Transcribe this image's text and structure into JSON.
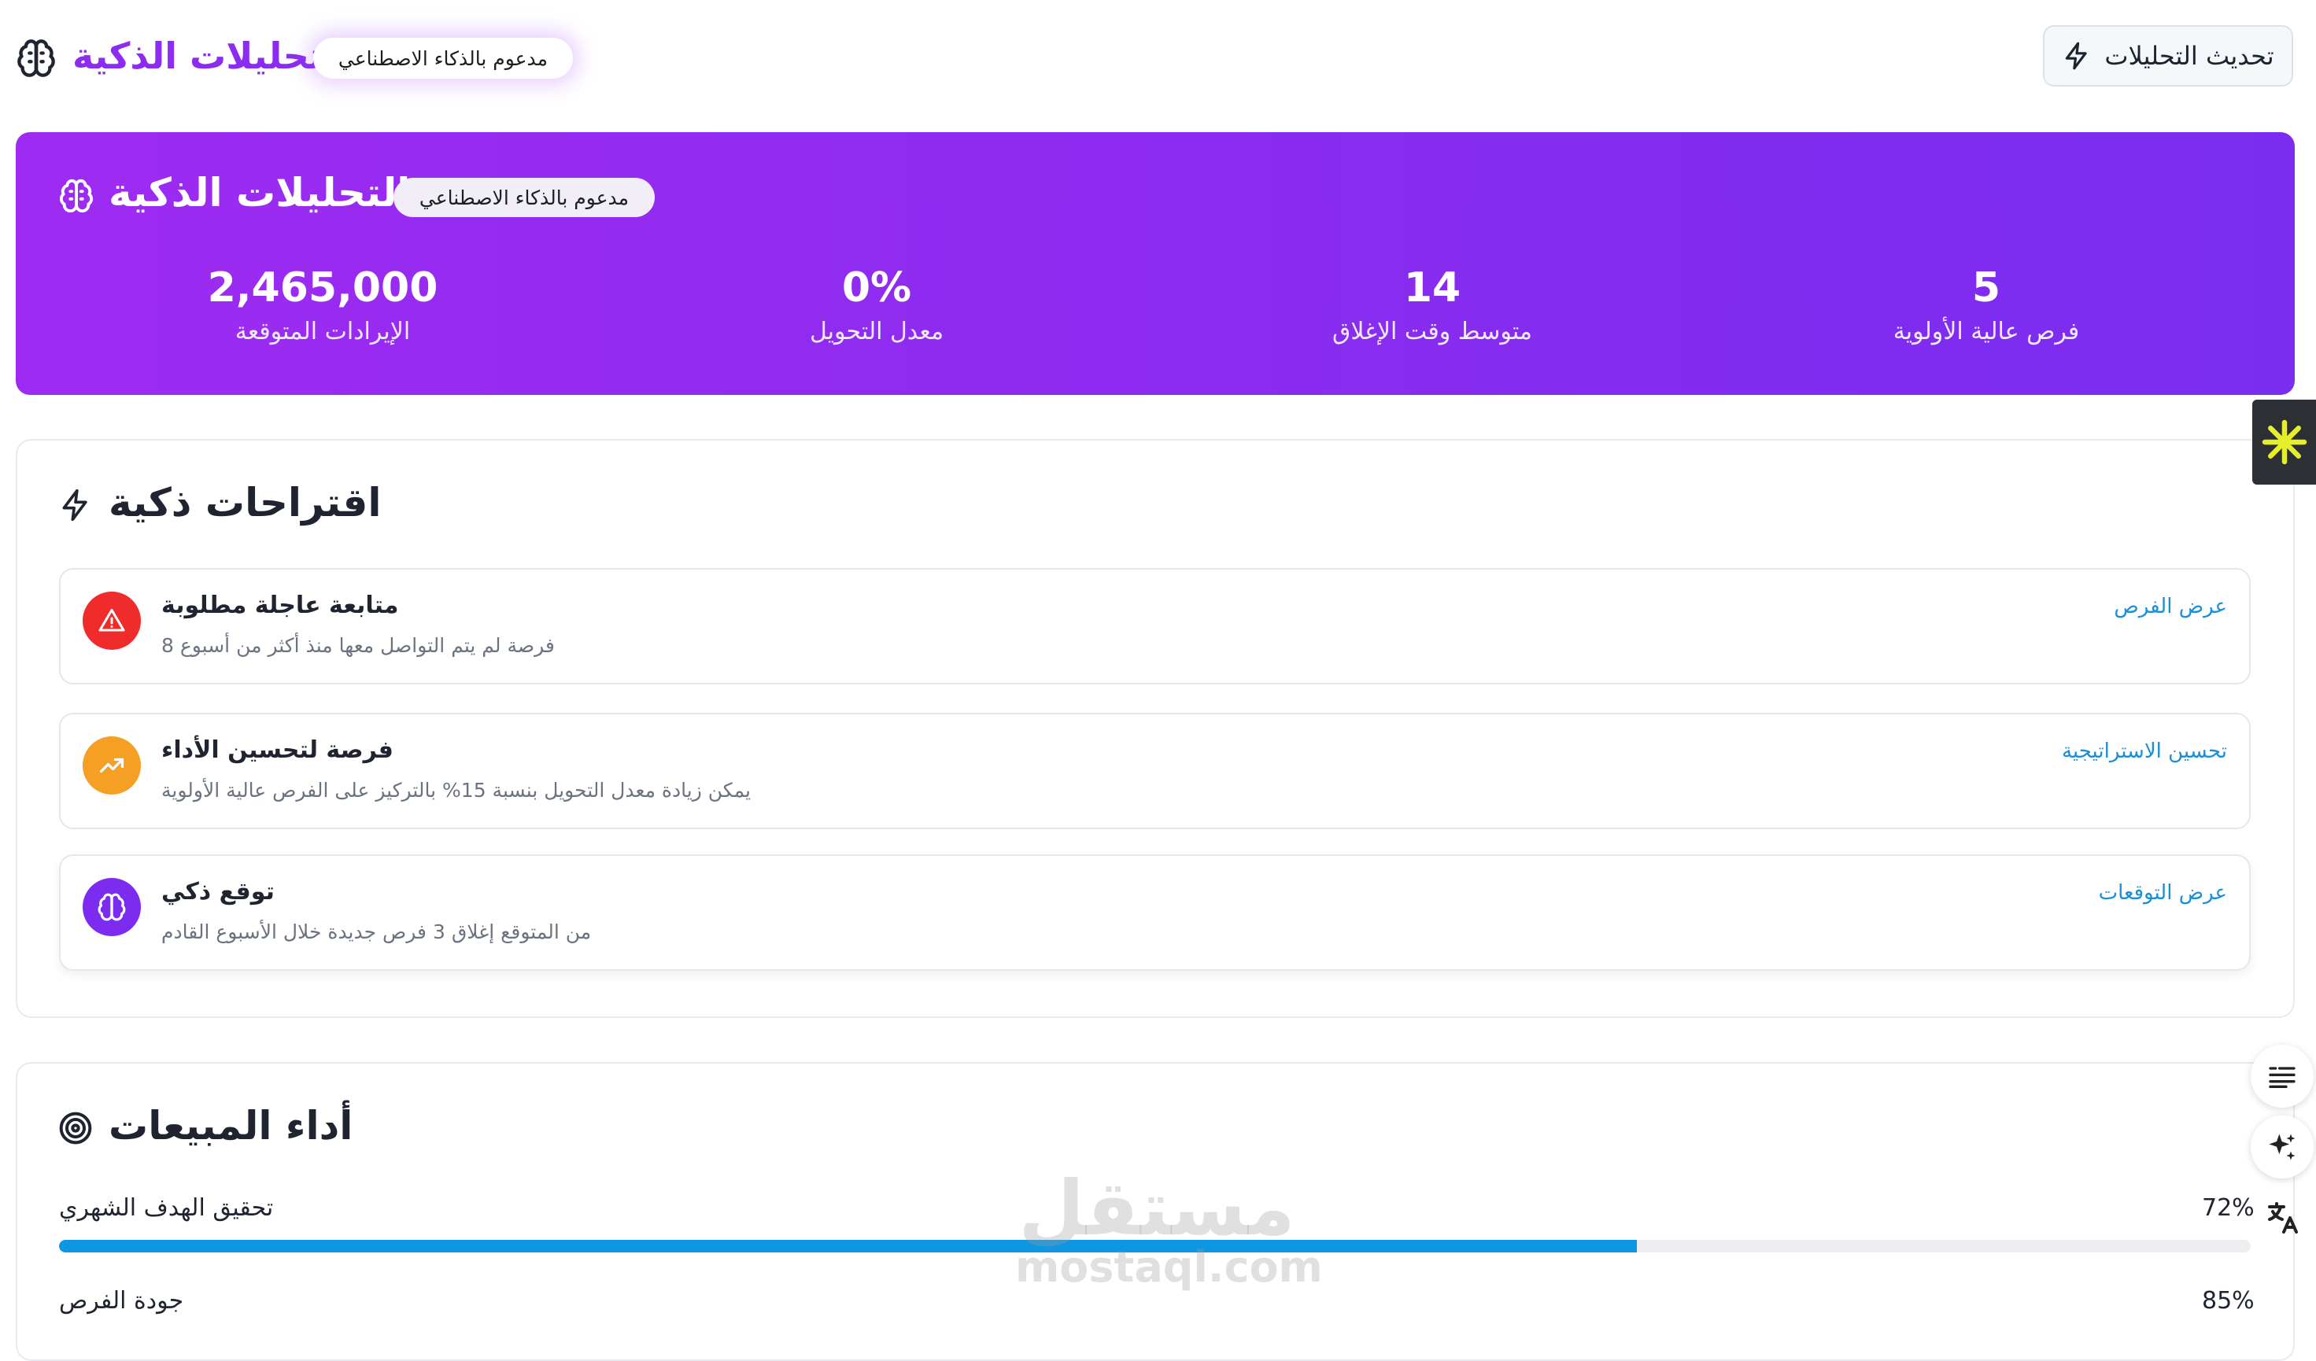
{
  "header": {
    "title": "التحليلات الذكية",
    "ai_badge": "مدعوم بالذكاء الاصطناعي",
    "refresh_label": "تحديث التحليلات"
  },
  "hero": {
    "title": "التحليلات الذكية",
    "ai_badge": "مدعوم بالذكاء الاصطناعي",
    "stats": [
      {
        "value": "2,465,000",
        "label": "الإيرادات المتوقعة"
      },
      {
        "value": "0%",
        "label": "معدل التحويل"
      },
      {
        "value": "14",
        "label": "متوسط وقت الإغلاق"
      },
      {
        "value": "5",
        "label": "فرص عالية الأولوية"
      }
    ]
  },
  "suggestions": {
    "title": "اقتراحات ذكية",
    "items": [
      {
        "title": "متابعة عاجلة مطلوبة",
        "description": "فرصة لم يتم التواصل معها منذ أكثر من أسبوع 8",
        "link": "عرض الفرص",
        "icon": "alert-triangle-icon",
        "color": "#ef2b2b"
      },
      {
        "title": "فرصة لتحسين الأداء",
        "description": "يمكن زيادة معدل التحويل بنسبة 15% بالتركيز على الفرص عالية الأولوية",
        "link": "تحسين الاستراتيجية",
        "icon": "trending-up-icon",
        "color": "#f59f25"
      },
      {
        "title": "توقع ذكي",
        "description": "من المتوقع إغلاق 3 فرص جديدة خلال الأسبوع القادم",
        "link": "عرض التوقعات",
        "icon": "brain-icon",
        "color": "#7b2cf0"
      }
    ]
  },
  "sales": {
    "title": "أداء المبيعات",
    "metrics": [
      {
        "label": "تحقيق الهدف الشهري",
        "percent_text": "72%",
        "value": 72
      },
      {
        "label": "جودة الفرص",
        "percent_text": "85%",
        "value": 85
      }
    ]
  },
  "watermark": {
    "arabic": "مستقل",
    "latin": "mostaql.com"
  },
  "colors": {
    "accent": "#8b2cf0",
    "progress": "#0e96e2",
    "link": "#1a8fd6"
  }
}
